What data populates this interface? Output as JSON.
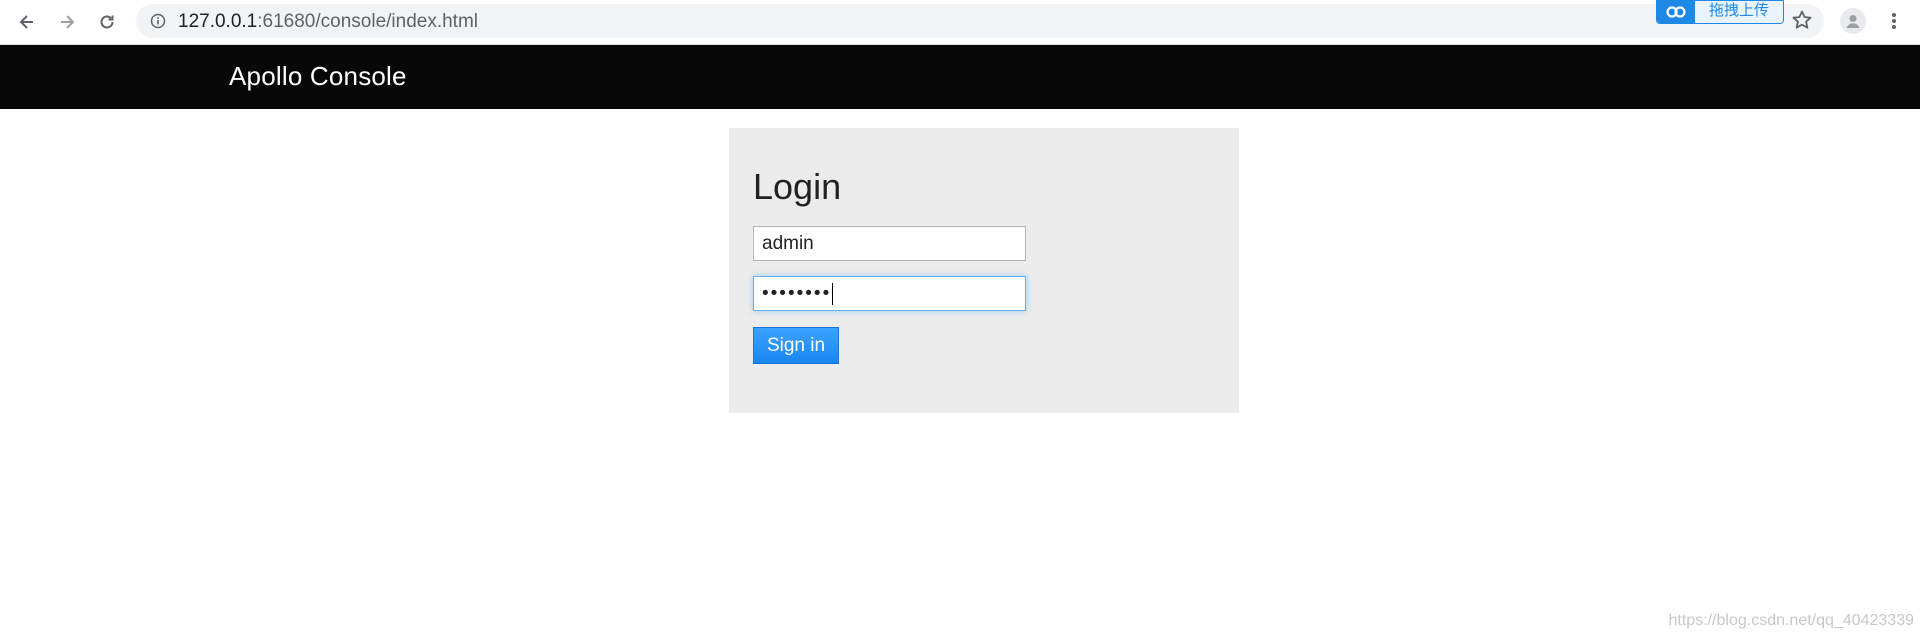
{
  "browser": {
    "url_host": "127.0.0.1",
    "url_rest": ":61680/console/index.html",
    "upload_badge_text": "拖拽上传",
    "icons": [
      "back-icon",
      "forward-icon",
      "reload-icon",
      "info-icon",
      "star-icon",
      "avatar-icon",
      "more-icon"
    ]
  },
  "navbar": {
    "brand": "Apollo Console"
  },
  "login": {
    "title": "Login",
    "username_value": "admin",
    "password_masked": "••••••••",
    "signin_label": "Sign in"
  },
  "footer": {
    "watermark": "https://blog.csdn.net/qq_40423339"
  },
  "colors": {
    "navbar_bg": "#080808",
    "panel_bg": "#ececec",
    "button_blue": "#1a86f0"
  }
}
